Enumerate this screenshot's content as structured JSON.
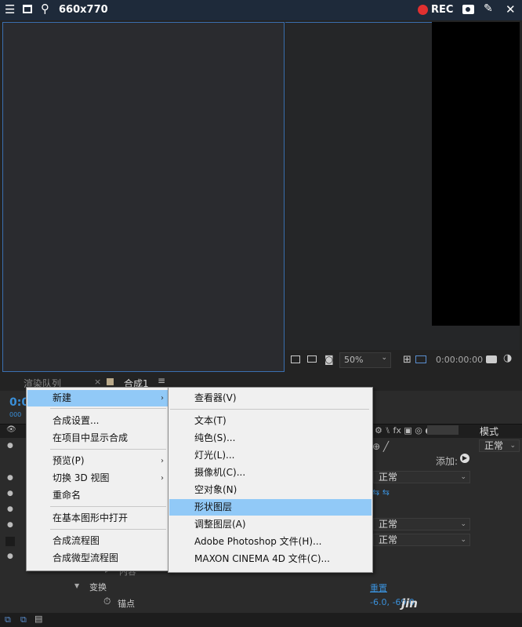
{
  "recorder": {
    "size_label": "660x770",
    "rec_label": "REC",
    "icons": [
      "menu-icon",
      "window-icon",
      "magnifier-icon",
      "record-dot-icon",
      "camera-icon",
      "pencil-icon",
      "close-icon"
    ]
  },
  "viewer": {
    "zoom": "50%",
    "timecode": "0:00:00:00"
  },
  "timeline": {
    "tab_render_queue": "渲染队列",
    "tab_comp": "合成1",
    "timecode_partial": "0:0",
    "frame_partial": "000",
    "mode_header": "模式",
    "blend_modes": [
      "正常",
      "正常",
      "正常",
      "正常"
    ],
    "add_label": "添加:",
    "contents_label": "内容",
    "transform_label": "变换",
    "reset_label": "重置",
    "anchor_label": "锚点",
    "anchor_value": "-6.0, -69.0"
  },
  "context_menu": {
    "items": [
      {
        "label": "新建",
        "has_submenu": true,
        "highlighted": true
      },
      {
        "label": "合成设置..."
      },
      {
        "label": "在项目中显示合成"
      },
      {
        "label": "预览(P)",
        "has_submenu": true
      },
      {
        "label": "切换 3D 视图",
        "has_submenu": true
      },
      {
        "label": "重命名"
      },
      {
        "label": "在基本图形中打开"
      },
      {
        "label": "合成流程图"
      },
      {
        "label": "合成微型流程图"
      }
    ]
  },
  "submenu": {
    "items": [
      {
        "label": "查看器(V)"
      },
      {
        "label": "文本(T)"
      },
      {
        "label": "纯色(S)..."
      },
      {
        "label": "灯光(L)..."
      },
      {
        "label": "摄像机(C)..."
      },
      {
        "label": "空对象(N)"
      },
      {
        "label": "形状图层",
        "highlighted": true
      },
      {
        "label": "调整图层(A)"
      },
      {
        "label": "Adobe Photoshop 文件(H)..."
      },
      {
        "label": "MAXON CINEMA 4D 文件(C)..."
      }
    ]
  },
  "watermark": "jin"
}
